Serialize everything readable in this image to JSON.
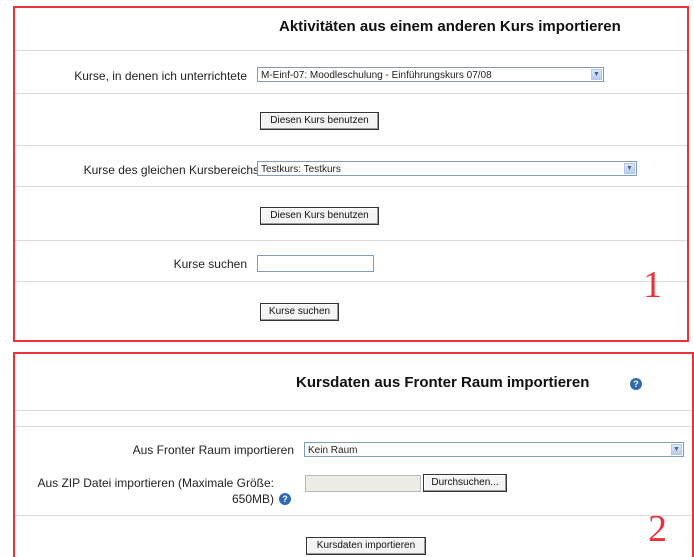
{
  "section1": {
    "title": "Aktivitäten aus einem anderen Kurs importieren",
    "row1_label": "Kurse, in denen ich unterrichtete",
    "row1_select_value": "M-Einf-07: Moodleschulung - Einführungskurs 07/08",
    "use_course_label": "Diesen Kurs benutzen",
    "row2_label": "Kurse des gleichen Kursbereichs",
    "row2_select_value": "Testkurs: Testkurs",
    "search_label": "Kurse suchen",
    "search_value": "",
    "search_button_label": "Kurse suchen",
    "number": "1"
  },
  "section2": {
    "title": "Kursdaten aus Fronter Raum importieren",
    "fronter_label": "Aus Fronter Raum importieren",
    "fronter_select_value": "Kein Raum",
    "zip_label_line1": "Aus ZIP Datei importieren (Maximale Größe:",
    "zip_label_line2": "650MB)",
    "browse_label": "Durchsuchen...",
    "import_button_label": "Kursdaten importieren",
    "number": "2"
  },
  "icons": {
    "help": "help-icon",
    "dropdown": "chevron-down-icon"
  },
  "colors": {
    "highlight_border": "#e8333b",
    "help_icon": "#2f6bb3"
  }
}
